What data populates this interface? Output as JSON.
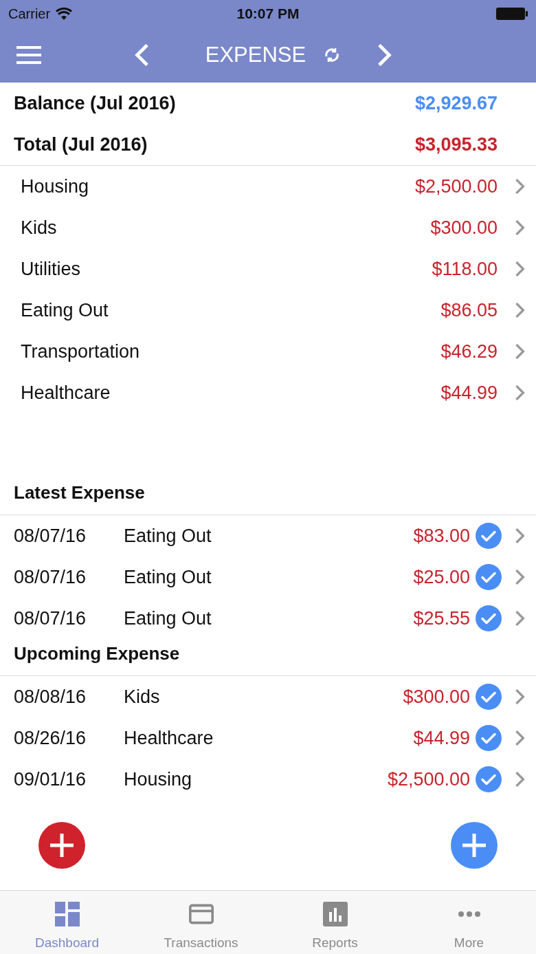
{
  "status_bar": {
    "carrier": "Carrier",
    "time": "10:07 PM"
  },
  "nav": {
    "title": "EXPENSE"
  },
  "summary": [
    {
      "label": "Balance (Jul 2016)",
      "amount": "$2,929.67",
      "kind": "balance"
    },
    {
      "label": "Total (Jul 2016)",
      "amount": "$3,095.33",
      "kind": "total"
    }
  ],
  "categories": [
    {
      "name": "Housing",
      "amount": "$2,500.00"
    },
    {
      "name": "Kids",
      "amount": "$300.00"
    },
    {
      "name": "Utilities",
      "amount": "$118.00"
    },
    {
      "name": "Eating Out",
      "amount": "$86.05"
    },
    {
      "name": "Transportation",
      "amount": "$46.29"
    },
    {
      "name": "Healthcare",
      "amount": "$44.99"
    }
  ],
  "sections": [
    {
      "title": "Latest Expense",
      "rows": [
        {
          "date": "08/07/16",
          "category": "Eating Out",
          "amount": "$83.00",
          "cleared": true
        },
        {
          "date": "08/07/16",
          "category": "Eating Out",
          "amount": "$25.00",
          "cleared": true
        },
        {
          "date": "08/07/16",
          "category": "Eating Out",
          "amount": "$25.55",
          "cleared": true
        }
      ]
    },
    {
      "title": "Upcoming Expense",
      "rows": [
        {
          "date": "08/08/16",
          "category": "Kids",
          "amount": "$300.00",
          "cleared": true
        },
        {
          "date": "08/26/16",
          "category": "Healthcare",
          "amount": "$44.99",
          "cleared": true
        },
        {
          "date": "09/01/16",
          "category": "Housing",
          "amount": "$2,500.00",
          "cleared": true
        }
      ]
    }
  ],
  "tabs": [
    {
      "label": "Dashboard",
      "kind": "dashboard",
      "selected": true
    },
    {
      "label": "Transactions",
      "kind": "card",
      "selected": false
    },
    {
      "label": "Reports",
      "kind": "chart",
      "selected": false
    },
    {
      "label": "More",
      "kind": "more",
      "selected": false
    }
  ]
}
